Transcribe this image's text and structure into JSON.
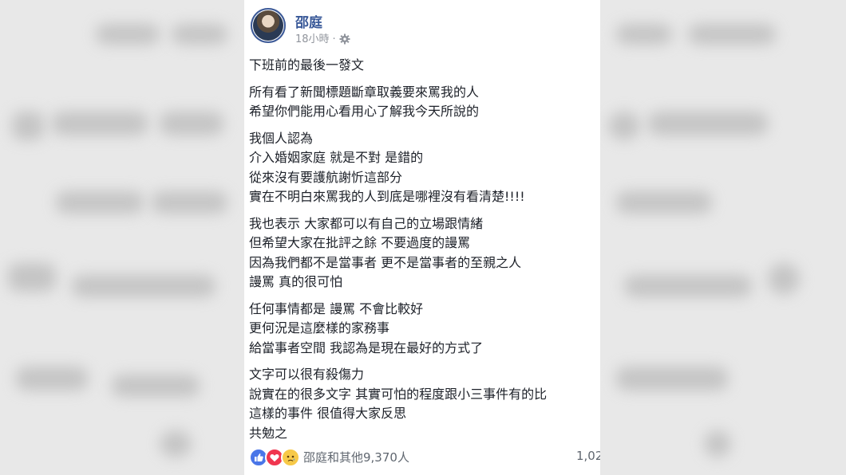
{
  "post": {
    "author": "邵庭",
    "time": "18小時",
    "separator": "·",
    "privacy_icon": "gear-icon",
    "paragraphs": [
      [
        "下班前的最後一發文"
      ],
      [
        "所有看了新聞標題斷章取義要來罵我的人",
        "希望你們能用心看用心了解我今天所說的"
      ],
      [
        "我個人認為",
        "介入婚姻家庭 就是不對 是錯的",
        "從來沒有要護航謝忻這部分",
        "實在不明白來罵我的人到底是哪裡沒有看清楚!!!!"
      ],
      [
        "我也表示 大家都可以有自己的立場跟情緒",
        "但希望大家在批評之餘 不要過度的謾罵",
        "因為我們都不是當事者 更不是當事者的至親之人",
        "謾罵 真的很可怕"
      ],
      [
        "任何事情都是 謾罵 不會比較好",
        "更何況是這麼樣的家務事",
        "給當事者空間 我認為是現在最好的方式了"
      ],
      [
        "文字可以很有殺傷力",
        "說實在的很多文字 其實可怕的程度跟小三事件有的比",
        "這樣的事件 很值得大家反思",
        "共勉之"
      ]
    ],
    "reactions": {
      "icons": [
        "like-icon",
        "love-icon",
        "sad-icon"
      ],
      "text": "邵庭和其他9,370人",
      "comments": "1,02"
    }
  },
  "colors": {
    "author": "#385898",
    "like": "#4a76e8",
    "love": "#f0364f",
    "sad": "#f7c948"
  }
}
